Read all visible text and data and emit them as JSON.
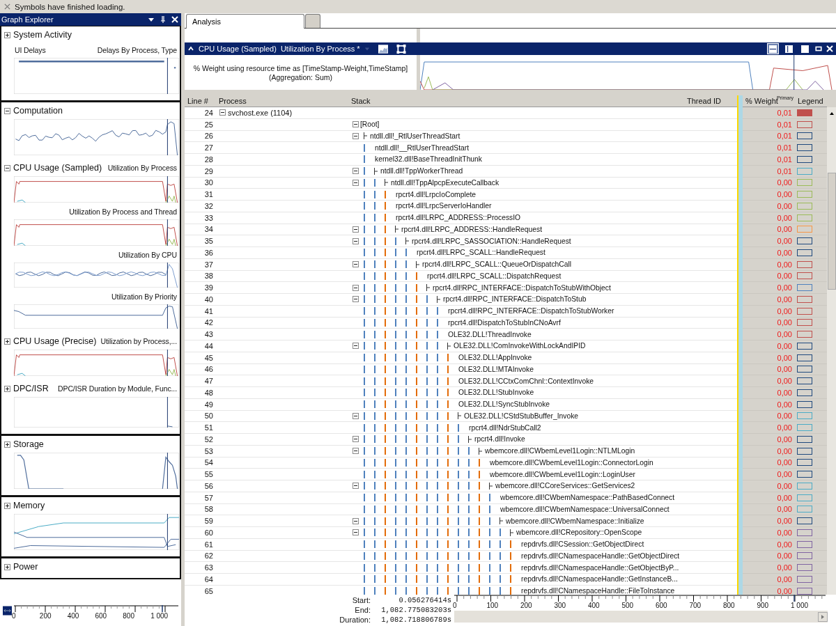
{
  "status_bar": {
    "message": "Symbols have finished loading."
  },
  "graph_explorer": {
    "title": "Graph Explorer",
    "groups": [
      {
        "sections": [
          {
            "title": "System Activity",
            "expanded": false,
            "graphs": [
              {
                "label_left": "UI Delays",
                "label": "Delays By Process, Type",
                "kind": "delays"
              }
            ]
          }
        ]
      },
      {
        "sections": [
          {
            "title": "Computation",
            "expanded": true,
            "graphs": [
              {
                "kind": "wavy"
              }
            ]
          },
          {
            "title": "CPU Usage (Sampled)",
            "label": "Utilization By Process",
            "expanded": true,
            "graphs": [
              {
                "kind": "plateau"
              },
              {
                "label": "Utilization By Process and Thread",
                "kind": "plateau"
              },
              {
                "label": "Utilization By CPU",
                "kind": "cpu"
              },
              {
                "label": "Utilization By Priority",
                "kind": "priority"
              }
            ]
          },
          {
            "title": "CPU Usage (Precise)",
            "label": "Utilization by Process,...",
            "expanded": false,
            "graphs": [
              {
                "kind": "plateau"
              }
            ]
          },
          {
            "title": "DPC/ISR",
            "label": "DPC/ISR Duration by Module, Func...",
            "expanded": false,
            "graphs": [
              {
                "kind": "empty"
              }
            ]
          }
        ]
      },
      {
        "sections": [
          {
            "title": "Storage",
            "expanded": false,
            "graphs": [
              {
                "kind": "storage"
              }
            ]
          }
        ]
      },
      {
        "sections": [
          {
            "title": "Memory",
            "expanded": false,
            "graphs": [
              {
                "kind": "memory"
              }
            ]
          }
        ]
      },
      {
        "sections": [
          {
            "title": "Power",
            "expanded": false
          }
        ]
      }
    ],
    "timeline": {
      "ticks": [
        "0",
        "200",
        "400",
        "600",
        "800",
        "1 000"
      ]
    }
  },
  "tabs": [
    {
      "label": "Analysis",
      "selected": true
    },
    {
      "selected": false
    }
  ],
  "panel": {
    "title": "CPU Usage (Sampled)",
    "view": "Utilization By Process *",
    "layout_buttons": [
      {
        "kind": "graph-table",
        "selected": true
      },
      {
        "kind": "table",
        "selected": false
      },
      {
        "kind": "graph",
        "selected": false
      }
    ],
    "info_lines": [
      "% Weight using resource time as [TimeStamp-Weight,TimeStamp]",
      "(Aggregation: Sum)"
    ]
  },
  "table": {
    "columns": [
      "Line #",
      "Process",
      "Stack",
      "Thread ID",
      "% Weight",
      "Legend"
    ],
    "sort_note": "Primary",
    "rows": [
      {
        "line": "24",
        "process": "svchost.exe (1104)",
        "expanded": true,
        "weight": "0,01",
        "color": "#c0504d",
        "filled": true,
        "children": [
          {
            "line": "25",
            "stack": "[Root]",
            "expanded": true,
            "weight": "0,01",
            "color": "#c0504d",
            "filled": false,
            "children": [
              {
                "line": "26",
                "stack": "ntdll.dll!_RtlUserThreadStart",
                "expanded": true,
                "weight": "0,01",
                "color": "#1f497d",
                "filled": false,
                "children": [
                  {
                    "line": "27",
                    "stack": "ntdll.dll!__RtlUserThreadStart",
                    "weight": "0,01",
                    "color": "#1f497d",
                    "filled": false
                  },
                  {
                    "line": "28",
                    "stack": "kernel32.dll!BaseThreadInitThunk",
                    "weight": "0,01",
                    "color": "#1f497d",
                    "filled": false
                  },
                  {
                    "line": "29",
                    "stack": "ntdll.dll!TppWorkerThread",
                    "expanded": true,
                    "weight": "0,01",
                    "color": "#4bacc6",
                    "filled": false,
                    "children": [
                      {
                        "line": "30",
                        "stack": "ntdll.dll!TppAlpcpExecuteCallback",
                        "expanded": true,
                        "weight": "0,00",
                        "color": "#9bbb59",
                        "filled": false,
                        "children": [
                          {
                            "line": "31",
                            "stack": "rpcrt4.dll!LrpcIoComplete",
                            "weight": "0,00",
                            "color": "#9bbb59",
                            "filled": false
                          },
                          {
                            "line": "32",
                            "stack": "rpcrt4.dll!LrpcServerIoHandler",
                            "weight": "0,00",
                            "color": "#9bbb59",
                            "filled": false
                          },
                          {
                            "line": "33",
                            "stack": "rpcrt4.dll!LRPC_ADDRESS::ProcessIO",
                            "weight": "0,00",
                            "color": "#9bbb59",
                            "filled": false
                          },
                          {
                            "line": "34",
                            "stack": "rpcrt4.dll!LRPC_ADDRESS::HandleRequest",
                            "expanded": true,
                            "weight": "0,00",
                            "color": "#f79646",
                            "filled": false,
                            "children": [
                              {
                                "line": "35",
                                "stack": "rpcrt4.dll!LRPC_SASSOCIATION::HandleRequest",
                                "expanded": true,
                                "weight": "0,00",
                                "color": "#1f497d",
                                "filled": false,
                                "children": [
                                  {
                                    "line": "36",
                                    "stack": "rpcrt4.dll!LRPC_SCALL::HandleRequest",
                                    "weight": "0,00",
                                    "color": "#1f497d",
                                    "filled": false
                                  },
                                  {
                                    "line": "37",
                                    "stack": "rpcrt4.dll!LRPC_SCALL::QueueOrDispatchCall",
                                    "expanded": true,
                                    "weight": "0,00",
                                    "color": "#c0504d",
                                    "filled": false,
                                    "children": [
                                      {
                                        "line": "38",
                                        "stack": "rpcrt4.dll!LRPC_SCALL::DispatchRequest",
                                        "weight": "0,00",
                                        "color": "#c0504d",
                                        "filled": false
                                      },
                                      {
                                        "line": "39",
                                        "stack": "rpcrt4.dll!RPC_INTERFACE::DispatchToStubWithObject",
                                        "expanded": true,
                                        "weight": "0,00",
                                        "color": "#4f81bd",
                                        "filled": false,
                                        "children": [
                                          {
                                            "line": "40",
                                            "stack": "rpcrt4.dll!RPC_INTERFACE::DispatchToStub",
                                            "expanded": true,
                                            "weight": "0,00",
                                            "color": "#c0504d",
                                            "filled": false,
                                            "children": [
                                              {
                                                "line": "41",
                                                "stack": "rpcrt4.dll!RPC_INTERFACE::DispatchToStubWorker",
                                                "weight": "0,00",
                                                "color": "#c0504d",
                                                "filled": false
                                              },
                                              {
                                                "line": "42",
                                                "stack": "rpcrt4.dll!DispatchToStubInCNoAvrf",
                                                "weight": "0,00",
                                                "color": "#c0504d",
                                                "filled": false
                                              },
                                              {
                                                "line": "43",
                                                "stack": "OLE32.DLL!ThreadInvoke",
                                                "weight": "0,00",
                                                "color": "#c0504d",
                                                "filled": false
                                              },
                                              {
                                                "line": "44",
                                                "stack": "OLE32.DLL!ComInvokeWithLockAndIPID",
                                                "expanded": true,
                                                "weight": "0,00",
                                                "color": "#1f497d",
                                                "filled": false,
                                                "children": [
                                                  {
                                                    "line": "45",
                                                    "stack": "OLE32.DLL!AppInvoke",
                                                    "weight": "0,00",
                                                    "color": "#1f497d",
                                                    "filled": false
                                                  },
                                                  {
                                                    "line": "46",
                                                    "stack": "OLE32.DLL!MTAInvoke",
                                                    "weight": "0,00",
                                                    "color": "#1f497d",
                                                    "filled": false
                                                  },
                                                  {
                                                    "line": "47",
                                                    "stack": "OLE32.DLL!CCtxComChnl::ContextInvoke",
                                                    "weight": "0,00",
                                                    "color": "#1f497d",
                                                    "filled": false
                                                  },
                                                  {
                                                    "line": "48",
                                                    "stack": "OLE32.DLL!StubInvoke",
                                                    "weight": "0,00",
                                                    "color": "#1f497d",
                                                    "filled": false
                                                  },
                                                  {
                                                    "line": "49",
                                                    "stack": "OLE32.DLL!SyncStubInvoke",
                                                    "weight": "0,00",
                                                    "color": "#1f497d",
                                                    "filled": false
                                                  },
                                                  {
                                                    "line": "50",
                                                    "stack": "OLE32.DLL!CStdStubBuffer_Invoke",
                                                    "expanded": true,
                                                    "weight": "0,00",
                                                    "color": "#4bacc6",
                                                    "filled": false,
                                                    "children": [
                                                      {
                                                        "line": "51",
                                                        "stack": "rpcrt4.dll!NdrStubCall2",
                                                        "weight": "0,00",
                                                        "color": "#4bacc6",
                                                        "filled": false
                                                      },
                                                      {
                                                        "line": "52",
                                                        "stack": "rpcrt4.dll!Invoke",
                                                        "expanded": true,
                                                        "weight": "0,00",
                                                        "color": "#1f497d",
                                                        "filled": false,
                                                        "children": [
                                                          {
                                                            "line": "53",
                                                            "stack": "wbemcore.dll!CWbemLevel1Login::NTLMLogin",
                                                            "expanded": true,
                                                            "weight": "0,00",
                                                            "color": "#1f497d",
                                                            "filled": false,
                                                            "children": [
                                                              {
                                                                "line": "54",
                                                                "stack": "wbemcore.dll!CWbemLevel1Login::ConnectorLogin",
                                                                "weight": "0,00",
                                                                "color": "#1f497d",
                                                                "filled": false
                                                              },
                                                              {
                                                                "line": "55",
                                                                "stack": "wbemcore.dll!CWbemLevel1Login::LoginUser",
                                                                "weight": "0,00",
                                                                "color": "#1f497d",
                                                                "filled": false
                                                              },
                                                              {
                                                                "line": "56",
                                                                "stack": "wbemcore.dll!CCoreServices::GetServices2",
                                                                "expanded": true,
                                                                "weight": "0,00",
                                                                "color": "#4bacc6",
                                                                "filled": false,
                                                                "children": [
                                                                  {
                                                                    "line": "57",
                                                                    "stack": "wbemcore.dll!CWbemNamespace::PathBasedConnect",
                                                                    "weight": "0,00",
                                                                    "color": "#4bacc6",
                                                                    "filled": false
                                                                  },
                                                                  {
                                                                    "line": "58",
                                                                    "stack": "wbemcore.dll!CWbemNamespace::UniversalConnect",
                                                                    "weight": "0,00",
                                                                    "color": "#4bacc6",
                                                                    "filled": false
                                                                  },
                                                                  {
                                                                    "line": "59",
                                                                    "stack": "wbemcore.dll!CWbemNamespace::Initialize",
                                                                    "expanded": true,
                                                                    "weight": "0,00",
                                                                    "color": "#1f497d",
                                                                    "filled": false,
                                                                    "children": [
                                                                      {
                                                                        "line": "60",
                                                                        "stack": "wbemcore.dll!CRepository::OpenScope",
                                                                        "expanded": true,
                                                                        "weight": "0,00",
                                                                        "color": "#8064a2",
                                                                        "filled": false,
                                                                        "children": [
                                                                          {
                                                                            "line": "61",
                                                                            "stack": "repdrvfs.dll!CSession::GetObjectDirect",
                                                                            "weight": "0,00",
                                                                            "color": "#8064a2",
                                                                            "filled": false
                                                                          },
                                                                          {
                                                                            "line": "62",
                                                                            "stack": "repdrvfs.dll!CNamespaceHandle::GetObjectDirect",
                                                                            "weight": "0,00",
                                                                            "color": "#8064a2",
                                                                            "filled": false
                                                                          },
                                                                          {
                                                                            "line": "63",
                                                                            "stack": "repdrvfs.dll!CNamespaceHandle::GetObjectByP...",
                                                                            "weight": "0,00",
                                                                            "color": "#8064a2",
                                                                            "filled": false
                                                                          },
                                                                          {
                                                                            "line": "64",
                                                                            "stack": "repdrvfs.dll!CNamespaceHandle::GetInstanceB...",
                                                                            "weight": "0,00",
                                                                            "color": "#8064a2",
                                                                            "filled": false
                                                                          },
                                                                          {
                                                                            "line": "65",
                                                                            "stack": "repdrvfs.dll!CNamespaceHandle::FileToInstance",
                                                                            "weight": "0,00",
                                                                            "color": "#8064a2",
                                                                            "filled": false
                                                                          }
                                                                        ]
                                                                      }
                                                                    ]
                                                                  }
                                                                ]
                                                              }
                                                            ]
                                                          }
                                                        ]
                                                      }
                                                    ]
                                                  }
                                                ]
                                              }
                                            ]
                                          }
                                        ]
                                      }
                                    ]
                                  }
                                ]
                              }
                            ]
                          }
                        ]
                      }
                    ]
                  }
                ]
              }
            ]
          }
        ]
      }
    ]
  },
  "time_range": [
    {
      "label": "Start:",
      "value": "0.056276414s"
    },
    {
      "label": "End:",
      "value": "1,082.775083203s"
    },
    {
      "label": "Duration:",
      "value": "1,082.718806789s"
    }
  ],
  "axis": {
    "ticks": [
      "0",
      "100",
      "200",
      "300",
      "400",
      "500",
      "600",
      "700",
      "800",
      "900",
      "1 000"
    ]
  }
}
